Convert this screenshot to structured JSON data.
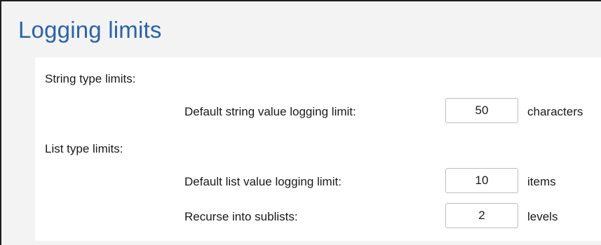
{
  "page": {
    "title": "Logging limits"
  },
  "string_limits": {
    "section_label": "String type limits:",
    "default_value": {
      "label": "Default string value logging limit:",
      "value": "50",
      "unit": "characters"
    }
  },
  "list_limits": {
    "section_label": "List type limits:",
    "default_value": {
      "label": "Default list value logging limit:",
      "value": "10",
      "unit": "items"
    },
    "recurse": {
      "label": "Recurse into sublists:",
      "value": "2",
      "unit": "levels"
    }
  }
}
